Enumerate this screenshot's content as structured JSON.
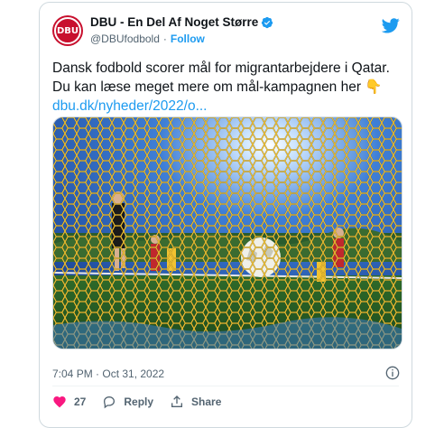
{
  "account": {
    "display_name": "DBU - En Del Af Noget Større",
    "handle": "@DBUfodbold",
    "separator": "·",
    "follow_label": "Follow",
    "avatar_text": "DBU"
  },
  "tweet": {
    "line1": "Dansk fodbold scorer mål for migrantarbejdere i Qatar.",
    "line2": "Du kan læse meget mere om mål-kampagnen her",
    "emoji": "👇",
    "link": "dbu.dk/nyheder/2022/o..."
  },
  "meta": {
    "timestamp": "7:04 PM · Oct 31, 2022"
  },
  "actions": {
    "like_count": "27",
    "reply_label": "Reply",
    "share_label": "Share"
  },
  "colors": {
    "brand": "#1d9bf0",
    "like": "#f91880",
    "dbu_red": "#c8102e",
    "net": "#f2c230"
  }
}
